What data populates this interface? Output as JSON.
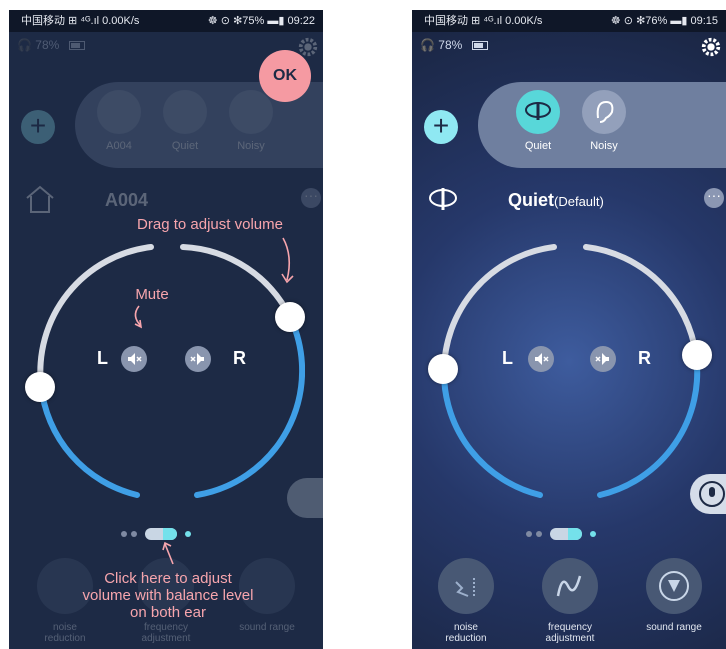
{
  "left_phone": {
    "status": {
      "left": "中国移动 ⊞ ⁴ᴳ.ıl 0.00K/s",
      "right": "☸ ⊙ ✻75% ▬▮ 09:22"
    },
    "battery_pct": "78%",
    "ok_label": "OK",
    "modes": [
      "A004",
      "Quiet",
      "Noisy"
    ],
    "preset_name": "A004",
    "tips": {
      "drag": "Drag to adjust volume",
      "mute": "Mute",
      "click": "Click here to adjust volume with balance level on both ear"
    },
    "left_label": "L",
    "right_label": "R",
    "tools": [
      "noise reduction",
      "frequency adjustment",
      "sound range"
    ]
  },
  "right_phone": {
    "status": {
      "left": "中国移动 ⊞ ⁴ᴳ.ıl 0.00K/s",
      "right": "☸ ⊙ ✻76% ▬▮ 09:15"
    },
    "battery_pct": "78%",
    "modes": [
      {
        "label": "Quiet",
        "state": "active",
        "icon": "quiet-lips-icon"
      },
      {
        "label": "Noisy",
        "state": "inactive",
        "icon": "ear-icon"
      }
    ],
    "preset_name": "Quiet",
    "preset_default": "(Default)",
    "left_label": "L",
    "right_label": "R",
    "tools": [
      {
        "label": "noise reduction",
        "icon": "noise-reduction-icon"
      },
      {
        "label": "frequency adjustment",
        "icon": "wave-icon"
      },
      {
        "label": "sound range",
        "icon": "sound-range-icon"
      }
    ]
  },
  "colors": {
    "accent_cyan": "#58d7d9",
    "ring_blue": "#3f9fe6",
    "tip_pink": "#f7a5ad",
    "ok_pink": "#f59aa2"
  }
}
